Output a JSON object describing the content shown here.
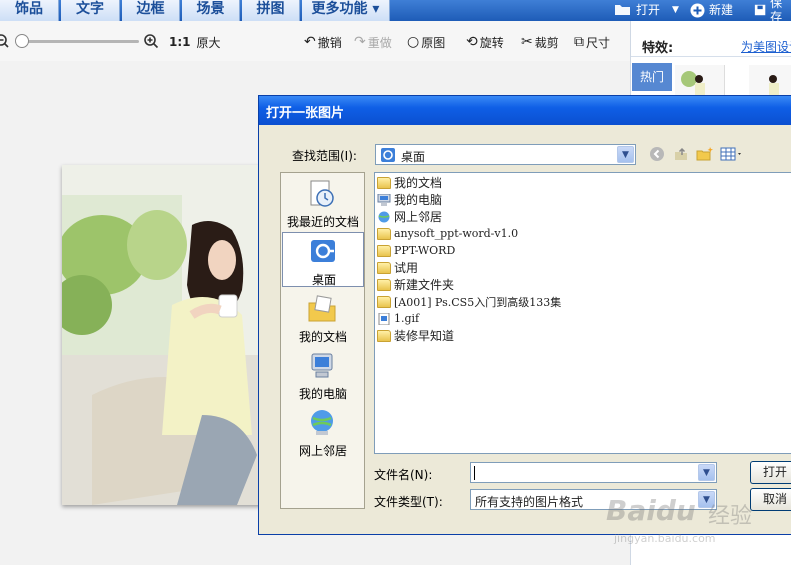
{
  "nav": {
    "tabs": [
      "饰品",
      "文字",
      "边框",
      "场景",
      "拼图",
      "更多功能"
    ],
    "more_arrow": "▾",
    "open_label": "打开",
    "new_label": "新建",
    "save_label": "保存"
  },
  "toolbar": {
    "ratio_label": "1:1",
    "original_size_label": "原大",
    "undo_label": "撤销",
    "redo_label": "重做",
    "original_label": "原图",
    "rotate_label": "旋转",
    "crop_label": "裁剪",
    "size_label": "尺寸"
  },
  "right_panel": {
    "effects_title": "特效:",
    "link_text": "为美图设计",
    "hot_tab": "热门"
  },
  "dialog": {
    "title": "打开一张图片",
    "look_in_label": "查找范围(I):",
    "look_in_value": "桌面",
    "places": [
      "我最近的文档",
      "桌面",
      "我的文档",
      "我的电脑",
      "网上邻居"
    ],
    "files": [
      {
        "name": "我的文档",
        "icon": "my-documents-icon"
      },
      {
        "name": "我的电脑",
        "icon": "my-computer-icon"
      },
      {
        "name": "网上邻居",
        "icon": "network-icon"
      },
      {
        "name": "anysoft_ppt-word-v1.0",
        "icon": "folder-icon"
      },
      {
        "name": "PPT-WORD",
        "icon": "folder-icon"
      },
      {
        "name": "试用",
        "icon": "folder-icon"
      },
      {
        "name": "新建文件夹",
        "icon": "folder-icon"
      },
      {
        "name": "[A001] Ps.CS5入门到高级133集",
        "icon": "folder-shortcut-icon"
      },
      {
        "name": "1.gif",
        "icon": "gif-file-icon"
      },
      {
        "name": "装修早知道",
        "icon": "folder-shortcut-icon"
      }
    ],
    "file_name_label": "文件名(N):",
    "file_name_value": "",
    "file_type_label": "文件类型(T):",
    "file_type_value": "所有支持的图片格式",
    "open_button": "打开",
    "cancel_button": "取消"
  },
  "watermark": {
    "brand": "Baidu",
    "suffix": "经验",
    "url": "jingyan.baidu.com"
  },
  "colors": {
    "nav_blue": "#1e5cb7",
    "dialog_title_blue": "#0b4fd0",
    "dialog_face": "#ece9d8",
    "link_blue": "#1c5fd0"
  }
}
